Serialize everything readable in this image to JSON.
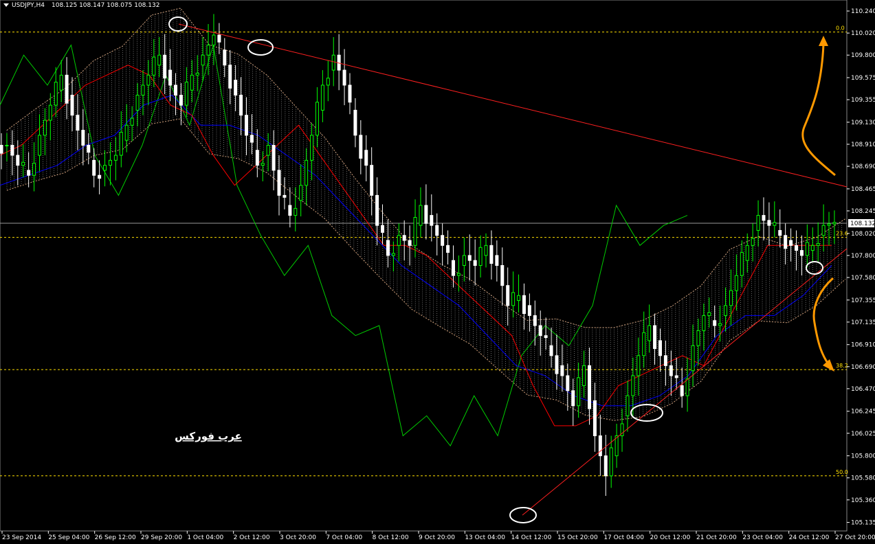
{
  "header": {
    "symbol_label": "USDJPY,H4",
    "ohlc_text": "108.125 108.147 108.075 108.132"
  },
  "watermark": "عرب فوركس",
  "colors": {
    "background": "#000000",
    "bull": "#00ff00",
    "bear": "#ffffff",
    "tenkan": "#ff0000",
    "kijun": "#0000ff",
    "chikou": "#00cc00",
    "cloud": "#d2a07a",
    "trendline": "#ff2020",
    "fib": "#ffe000",
    "arrow": "#ff9900",
    "marker": "#ffffff"
  },
  "icons": {
    "header_arrow": "triangle-down-icon",
    "orange_arrows": "curved-arrow-icon",
    "markers": "ellipse-icon"
  },
  "chart_data": {
    "type": "candlestick",
    "instrument": "USDJPY",
    "timeframe": "H4",
    "current_price": "108.132",
    "y_range": [
      105.05,
      110.35
    ],
    "y_ticks": [
      "110.240",
      "110.020",
      "109.800",
      "109.575",
      "109.355",
      "109.130",
      "108.910",
      "108.690",
      "108.465",
      "108.245",
      "108.020",
      "107.800",
      "107.580",
      "107.355",
      "107.135",
      "106.910",
      "106.690",
      "106.470",
      "106.245",
      "106.025",
      "105.800",
      "105.580",
      "105.360",
      "105.135"
    ],
    "x_ticks": [
      "23 Sep 2014",
      "25 Sep 04:00",
      "26 Sep 12:00",
      "29 Sep 20:00",
      "1 Oct 04:00",
      "2 Oct 12:00",
      "3 Oct 20:00",
      "7 Oct 04:00",
      "8 Oct 12:00",
      "9 Oct 20:00",
      "13 Oct 04:00",
      "14 Oct 12:00",
      "15 Oct 20:00",
      "17 Oct 04:00",
      "20 Oct 12:00",
      "21 Oct 20:00",
      "23 Oct 04:00",
      "24 Oct 12:00",
      "27 Oct 20:00"
    ],
    "fibonacci": [
      {
        "label": "0.0",
        "price": 110.03
      },
      {
        "label": "23.6",
        "price": 107.98
      },
      {
        "label": "38.2",
        "price": 106.66
      },
      {
        "label": "50.0",
        "price": 105.6
      }
    ],
    "close_path": [
      108.9,
      108.7,
      108.6,
      109.0,
      109.3,
      109.6,
      109.2,
      108.9,
      108.6,
      108.7,
      108.8,
      109.1,
      109.4,
      109.6,
      109.8,
      109.5,
      109.3,
      109.6,
      109.8,
      110.0,
      109.7,
      109.4,
      109.0,
      108.7,
      108.9,
      108.4,
      108.2,
      108.5,
      109.0,
      109.5,
      109.8,
      109.5,
      109.0,
      108.7,
      108.1,
      107.8,
      108.0,
      107.9,
      108.3,
      108.1,
      107.9,
      107.6,
      107.8,
      107.7,
      107.9,
      107.7,
      107.3,
      107.4,
      107.2,
      107.0,
      106.8,
      106.6,
      106.3,
      106.7,
      106.0,
      105.6,
      106.0,
      106.4,
      106.8,
      107.1,
      106.8,
      106.6,
      106.4,
      106.9,
      107.2,
      107.1,
      107.3,
      107.6,
      107.9,
      108.2,
      108.1,
      108.0,
      107.9,
      107.8,
      107.9,
      108.1,
      108.13
    ],
    "tenkan_sen": [
      108.8,
      108.9,
      109.1,
      109.3,
      109.5,
      109.6,
      109.7,
      109.6,
      109.3,
      109.2,
      108.8,
      108.5,
      108.7,
      108.9,
      109.1,
      108.8,
      108.5,
      108.2,
      107.9,
      107.9,
      107.8,
      107.6,
      107.4,
      107.2,
      107.0,
      106.5,
      106.1,
      106.1,
      106.2,
      106.5,
      106.6,
      106.7,
      106.8,
      106.7,
      107.1,
      107.5,
      107.9,
      107.9,
      107.9,
      107.9
    ],
    "kijun_sen": [
      108.5,
      108.6,
      108.7,
      108.9,
      109.0,
      109.3,
      109.4,
      109.1,
      109.1,
      109.0,
      108.8,
      108.6,
      108.3,
      108.0,
      107.7,
      107.5,
      107.3,
      107.0,
      106.7,
      106.6,
      106.4,
      106.3,
      106.3,
      106.4,
      106.6,
      107.0,
      107.2,
      107.2,
      107.4,
      107.7
    ],
    "chikou_span": [
      109.3,
      109.8,
      109.5,
      109.9,
      108.8,
      108.4,
      108.9,
      109.6,
      109.1,
      109.9,
      108.5,
      108.0,
      107.6,
      107.9,
      107.2,
      107.0,
      107.1,
      106.0,
      106.2,
      105.9,
      106.4,
      106.0,
      106.8,
      107.1,
      106.9,
      107.3,
      108.3,
      107.9,
      108.1,
      108.2
    ]
  },
  "annotations": {
    "trendlines": [
      {
        "name": "resistance",
        "from": [
          "1 Oct 04:00",
          110.03
        ],
        "to": [
          "27 Oct 20:00",
          108.5
        ]
      },
      {
        "name": "support",
        "from": [
          "15 Oct 20:00",
          105.25
        ],
        "to": [
          "27 Oct 20:00",
          107.8
        ]
      }
    ]
  }
}
